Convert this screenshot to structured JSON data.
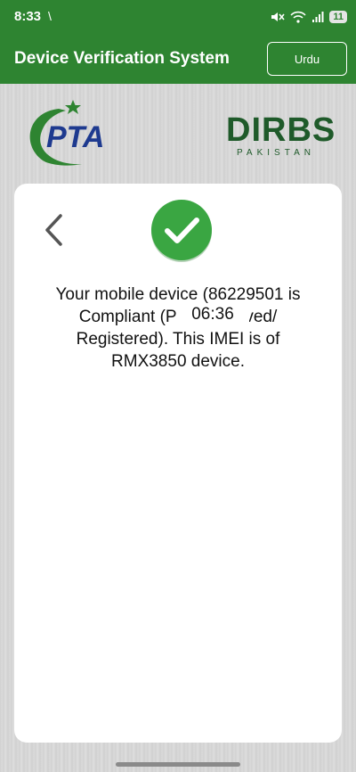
{
  "status_bar": {
    "time": "8:33",
    "notification_glyph": "\\",
    "battery": "11"
  },
  "app_bar": {
    "title": "Device Verification System",
    "language_button": "Urdu"
  },
  "logos": {
    "pta": "PTA",
    "dirbs": "DIRBS",
    "dirbs_subtitle": "PAKISTAN"
  },
  "result": {
    "message": "Your mobile device (86229501      is Compliant (PTA Approved/ Registered). This IMEI is of RMX3850 device.",
    "overlay_time": "06:36"
  },
  "colors": {
    "brand_green": "#2e8431",
    "check_green": "#3aa642",
    "pta_blue": "#1e3a8f"
  }
}
